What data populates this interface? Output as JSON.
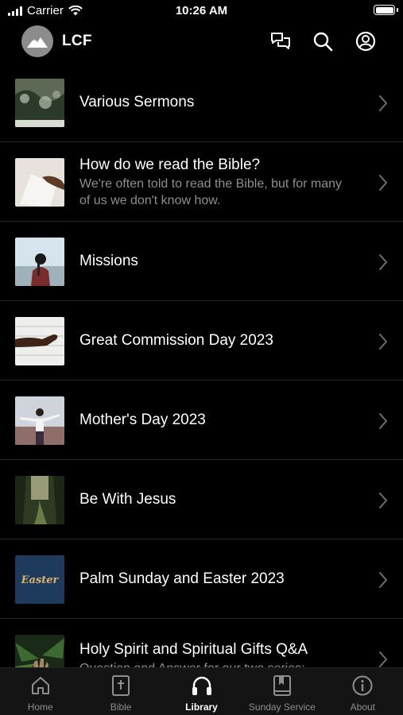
{
  "status_bar": {
    "carrier": "Carrier",
    "time": "10:26 AM",
    "battery_level": 1.0
  },
  "header": {
    "title": "LCF"
  },
  "series": [
    {
      "title": "Various Sermons",
      "subtitle": "",
      "thumb": "forest-frost"
    },
    {
      "title": "How do we read the Bible?",
      "subtitle": "We're often told to read the Bible, but for many of us we don't know how.",
      "thumb": "hand-paper"
    },
    {
      "title": "Missions",
      "subtitle": "",
      "thumb": "girl-sky"
    },
    {
      "title": "Great Commission Day 2023",
      "subtitle": "",
      "thumb": "reaching-hand"
    },
    {
      "title": "Mother's Day 2023",
      "subtitle": "",
      "thumb": "woman-arms-open"
    },
    {
      "title": "Be With Jesus",
      "subtitle": "",
      "thumb": "forest-path"
    },
    {
      "title": "Palm Sunday and Easter 2023",
      "subtitle": "",
      "thumb": "easter-text"
    },
    {
      "title": "Holy Spirit and Spiritual Gifts Q&A",
      "subtitle": "Question and Answer for our two series:",
      "thumb": "hand-leaves"
    }
  ],
  "thumb_text": {
    "easter": "Easter"
  },
  "tabbar": {
    "active": "library",
    "tabs": [
      {
        "id": "home",
        "label": "Home",
        "icon": "home-icon"
      },
      {
        "id": "bible",
        "label": "Bible",
        "icon": "bible-icon"
      },
      {
        "id": "library",
        "label": "Library",
        "icon": "headphones-icon"
      },
      {
        "id": "sunday",
        "label": "Sunday Service",
        "icon": "bookmark-book-icon"
      },
      {
        "id": "about",
        "label": "About",
        "icon": "info-icon"
      }
    ]
  },
  "colors": {
    "background": "#000000",
    "tabbar": "#141414",
    "subtitle": "#8e8e8e",
    "divider": "#262626",
    "easter_bg": "#1e3a5c",
    "easter_text": "#d9b56a"
  }
}
